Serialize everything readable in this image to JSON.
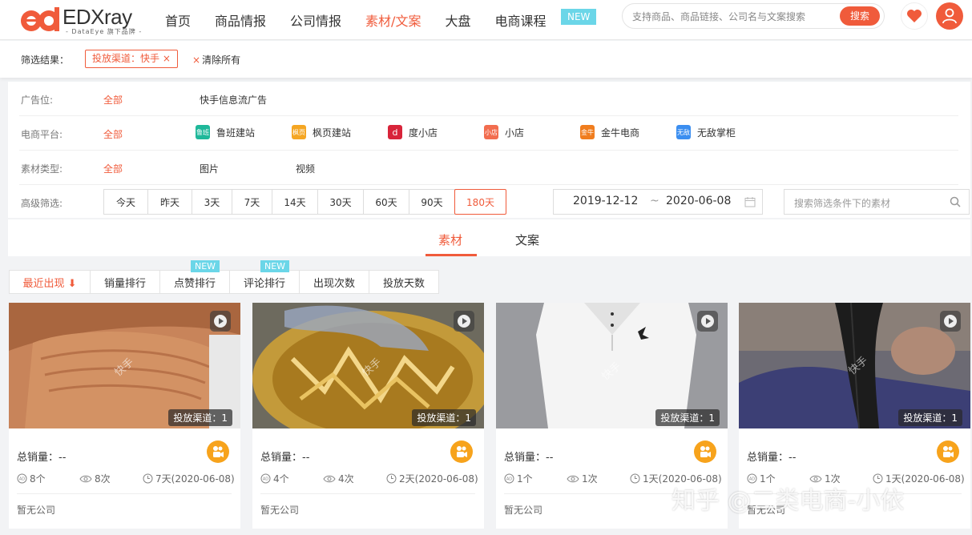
{
  "header": {
    "brand": "EDXray",
    "brand_sub": "- DataEye 旗下品牌 -",
    "nav": [
      "首页",
      "商品情报",
      "公司情报",
      "素材/文案",
      "大盘",
      "电商课程"
    ],
    "nav_badge": "NEW",
    "search_placeholder": "支持商品、商品链接、公司名与文案搜索",
    "search_button": "搜索",
    "accent": "#f05b3b"
  },
  "filter_result": {
    "label": "筛选结果：",
    "tag": "投放渠道：快手 ×",
    "clear": "清除所有"
  },
  "filters": {
    "ad_position": {
      "label": "广告位:",
      "all": "全部",
      "options": [
        "快手信息流广告"
      ]
    },
    "platform": {
      "label": "电商平台:",
      "all": "全部",
      "options": [
        {
          "icon": "鲁班",
          "name": "鲁班建站",
          "color": "#1fb89a"
        },
        {
          "icon": "枫页",
          "name": "枫页建站",
          "color": "#f5a623"
        },
        {
          "icon": "d",
          "name": "度小店",
          "color": "#d8243a"
        },
        {
          "icon": "小店",
          "name": "小店",
          "color": "#f26d4f"
        },
        {
          "icon": "金牛",
          "name": "金牛电商",
          "color": "#f07d1e"
        },
        {
          "icon": "无敌",
          "name": "无敌掌柜",
          "color": "#3b8ef0"
        }
      ]
    },
    "material_type": {
      "label": "素材类型:",
      "all": "全部",
      "options": [
        "图片",
        "视频"
      ]
    },
    "advanced": {
      "label": "高级筛选:",
      "days": [
        "今天",
        "昨天",
        "3天",
        "7天",
        "14天",
        "30天",
        "60天",
        "90天",
        "180天"
      ],
      "selected_day": "180天",
      "date_start": "2019-12-12",
      "date_sep": "~",
      "date_end": "2020-06-08",
      "search_placeholder": "搜索筛选条件下的素材"
    }
  },
  "tabs": [
    "素材",
    "文案"
  ],
  "active_tab": "素材",
  "sorts": [
    {
      "label": "最近出现 ⬇",
      "active": true,
      "badge": ""
    },
    {
      "label": "销量排行",
      "active": false,
      "badge": ""
    },
    {
      "label": "点赞排行",
      "active": false,
      "badge": "NEW"
    },
    {
      "label": "评论排行",
      "active": false,
      "badge": "NEW"
    },
    {
      "label": "出现次数",
      "active": false,
      "badge": ""
    },
    {
      "label": "投放天数",
      "active": false,
      "badge": ""
    }
  ],
  "cards": [
    {
      "channel": "投放渠道：1",
      "watermark": "快手",
      "sales_label": "总销量：",
      "sales_value": "--",
      "ads": "8个",
      "views": "8次",
      "days": "7天(2020-06-08)",
      "company": "暂无公司"
    },
    {
      "channel": "投放渠道：1",
      "watermark": "快手",
      "sales_label": "总销量：",
      "sales_value": "--",
      "ads": "4个",
      "views": "4次",
      "days": "2天(2020-06-08)",
      "company": "暂无公司"
    },
    {
      "channel": "投放渠道：1",
      "watermark": "快手",
      "sales_label": "总销量：",
      "sales_value": "--",
      "ads": "1个",
      "views": "1次",
      "days": "1天(2020-06-08)",
      "company": "暂无公司"
    },
    {
      "channel": "投放渠道：1",
      "watermark": "快手",
      "sales_label": "总销量：",
      "sales_value": "--",
      "ads": "1个",
      "views": "1次",
      "days": "1天(2020-06-08)",
      "company": "暂无公司"
    }
  ],
  "overlay_watermark": "知乎 @二类电商-小依"
}
